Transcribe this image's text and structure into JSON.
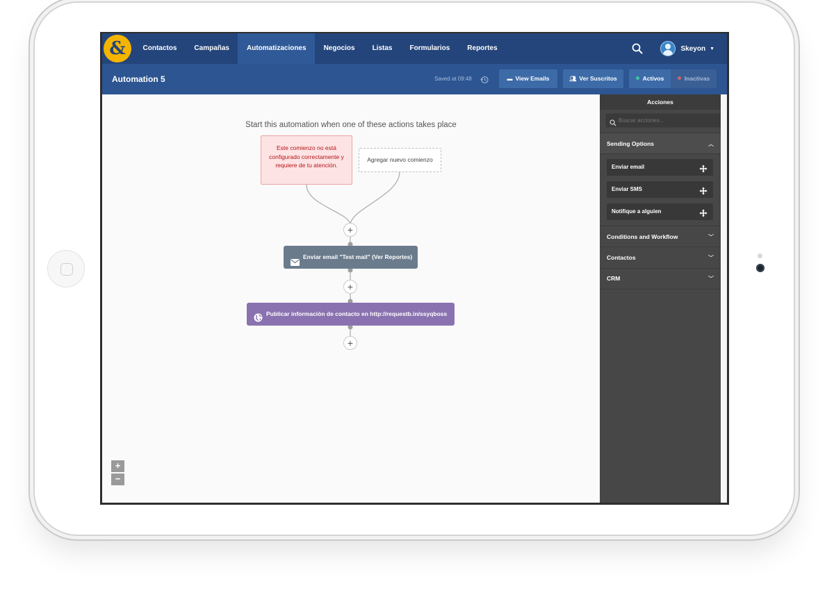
{
  "nav": {
    "logo": "&",
    "items": [
      "Contactos",
      "Campañas",
      "Automatizaciones",
      "Negocios",
      "Listas",
      "Formularios",
      "Reportes"
    ],
    "active_index": 2,
    "user_name": "Skeyon"
  },
  "header": {
    "title": "Automation 5",
    "saved": "Saved at 09:48",
    "view_emails": "View Emails",
    "ver_suscritos": "Ver Suscritos",
    "toggle_on": "Activos",
    "toggle_off": "Inactivas"
  },
  "canvas": {
    "start_text": "Start this automation when one of these actions takes place",
    "warning": "Este comienzo no está configurado correctamente y requiere de tu atención.",
    "add_start": "Agregar nuevo comienzo",
    "plus": "+",
    "node_email": "Enviar email \"Test mail\" (Ver Reportes)",
    "node_post": "Publicar información de contacto en http://requestb.in/ssyqboss",
    "zoom_in": "+",
    "zoom_out": "−"
  },
  "sidebar": {
    "title": "Acciones",
    "search_placeholder": "Buscar acciones...",
    "sections": [
      "Sending Options",
      "Conditions and Workflow",
      "Contactos",
      "CRM"
    ],
    "actions": [
      "Enviar email",
      "Enviar SMS",
      "Notifique a alguien"
    ]
  },
  "colors": {
    "nav": "#23457b",
    "subbar": "#2c5591",
    "logo": "#f5b400",
    "active_dot": "#3ec7a2",
    "inactive_dot": "#c9646b",
    "warning_bg": "#fde3e3",
    "warning_text": "#b3141a",
    "email_node": "#6a7b8c",
    "post_node": "#8a72b0",
    "sidebar": "#474747"
  },
  "icons": {
    "search": "search-icon",
    "history": "history-icon",
    "envelope": "envelope-icon",
    "globe": "globe-icon",
    "move": "move-icon",
    "users": "users-icon"
  }
}
